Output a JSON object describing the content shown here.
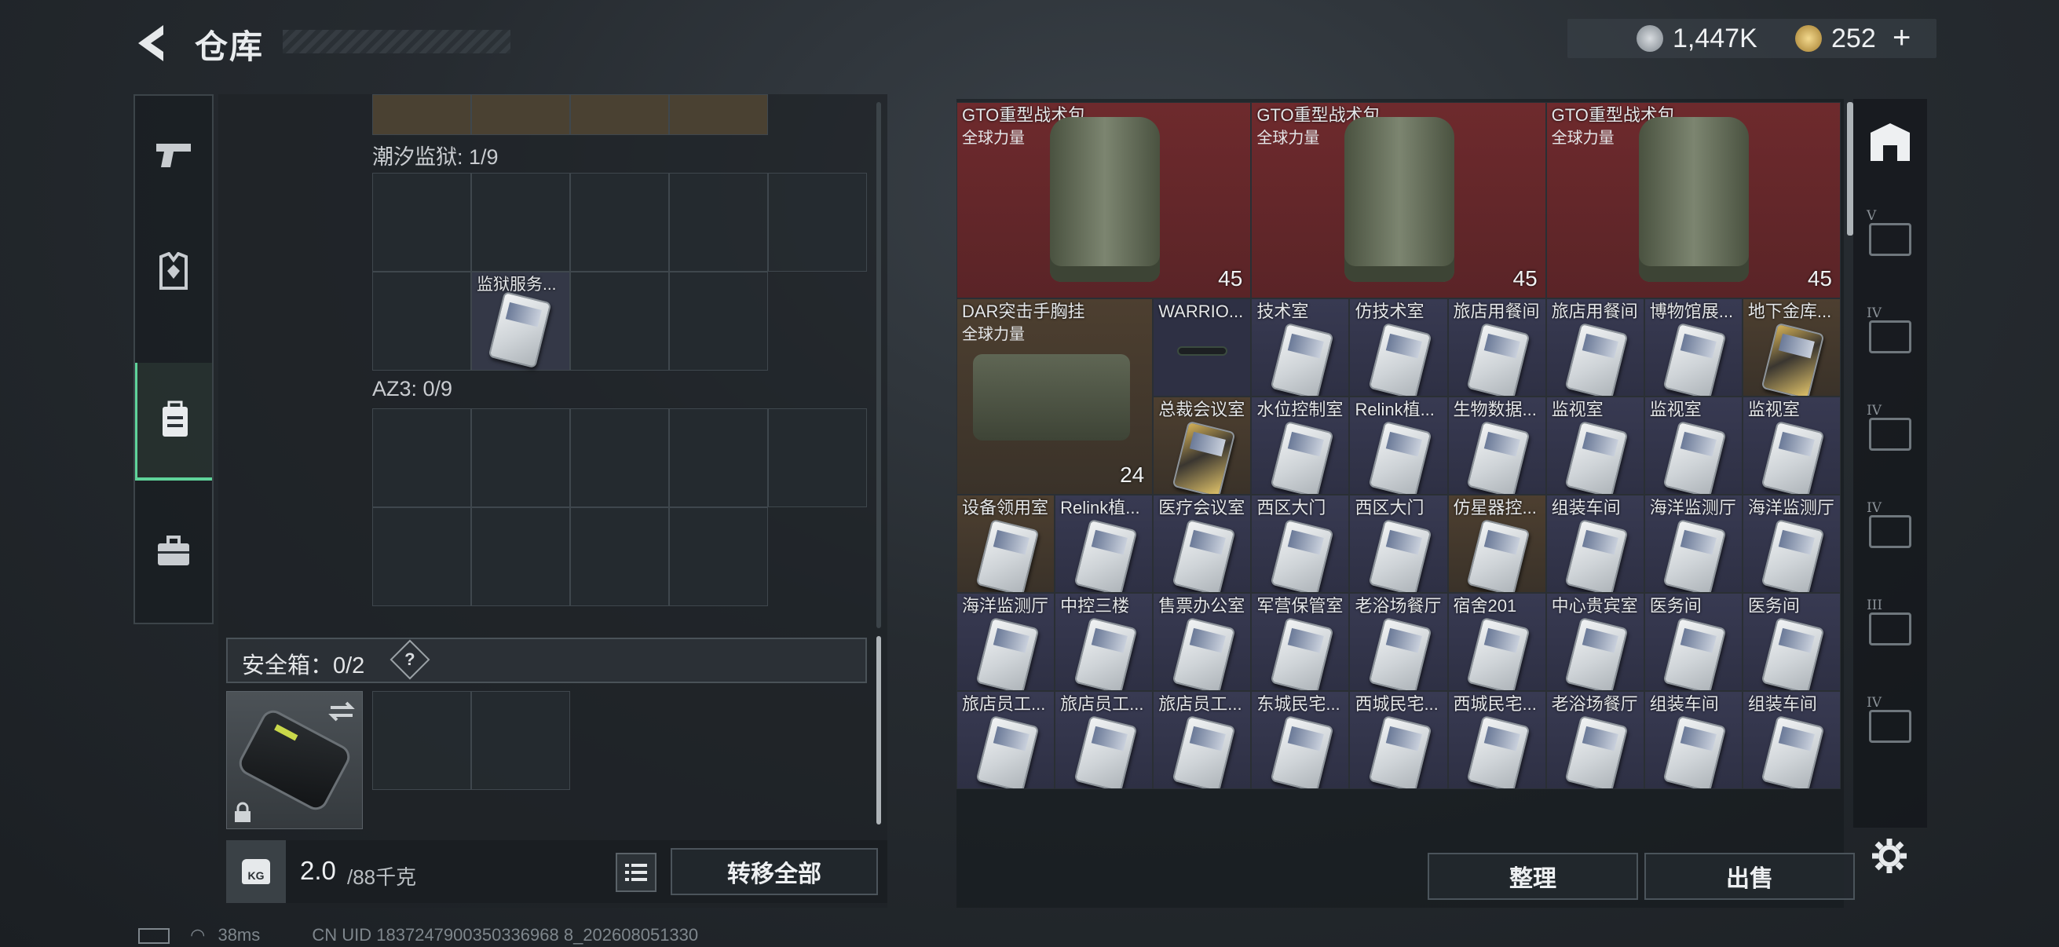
{
  "header": {
    "title": "仓库",
    "currency_silver": "1,447K",
    "currency_gold": "252",
    "gold_add": "+"
  },
  "left_sidebar": {
    "tabs": [
      {
        "icon": "pistol-icon",
        "active": false
      },
      {
        "icon": "vest-icon",
        "active": false
      },
      {
        "icon": "backpack-icon",
        "active": true
      },
      {
        "icon": "briefcase-icon",
        "active": false
      }
    ]
  },
  "middle": {
    "tide_prison_label": "潮汐监狱: 1/9",
    "tide_prison_item": "监狱服务...",
    "az3_label": "AZ3: 0/9",
    "safe_box_label": "安全箱：0/2",
    "safe_box_help": "?",
    "weight_value": "2.0",
    "weight_max": "/88千克",
    "weight_icon_label": "KG",
    "transfer_all": "转移全部"
  },
  "stash": {
    "big_items": [
      {
        "name": "GTO重型战术包",
        "sub": "全球力量",
        "count": "45"
      },
      {
        "name": "GTO重型战术包",
        "sub": "全球力量",
        "count": "45"
      },
      {
        "name": "GTO重型战术包",
        "sub": "全球力量",
        "count": "45"
      }
    ],
    "chest_rig": {
      "name": "DAR突击手胸挂",
      "sub": "全球力量",
      "count": "24"
    },
    "row1": [
      "WARRIO...",
      "技术室",
      "仿技术室",
      "旅店用餐间",
      "旅店用餐间",
      "博物馆展...",
      "地下金库..."
    ],
    "row2": [
      "总裁会议室",
      "水位控制室",
      "Relink植...",
      "生物数据...",
      "监视室",
      "监视室",
      "监视室"
    ],
    "row3": [
      "设备领用室",
      "Relink植...",
      "医疗会议室",
      "西区大门",
      "西区大门",
      "仿星器控...",
      "组装车间",
      "海洋监测厅",
      "海洋监测厅"
    ],
    "row4": [
      "海洋监测厅",
      "中控三楼",
      "售票办公室",
      "军营保管室",
      "老浴场餐厅",
      "宿舍201",
      "中心贵宾室",
      "医务间",
      "医务间"
    ],
    "row5": [
      "旅店员工...",
      "旅店员工...",
      "旅店员工...",
      "东城民宅...",
      "西城民宅...",
      "西城民宅...",
      "老浴场餐厅",
      "组装车间",
      "组装车间"
    ],
    "sort_button": "整理",
    "sell_button": "出售"
  },
  "right_sidebar": {
    "tabs": [
      {
        "icon": "home-stash-icon",
        "tier": ""
      },
      {
        "icon": "tier5-case-icon",
        "tier": "V"
      },
      {
        "icon": "tier4-medical-icon",
        "tier": "IV"
      },
      {
        "icon": "tier4-ammo-icon",
        "tier": "IV"
      },
      {
        "icon": "tier4-key-icon",
        "tier": "IV"
      },
      {
        "icon": "tier3-container-icon",
        "tier": "III"
      },
      {
        "icon": "tier4-tool-icon",
        "tier": "IV"
      }
    ]
  },
  "status_bar": {
    "ping": "38ms",
    "uid": "CN UID 1837247900350336968 8_202608051330"
  },
  "colors": {
    "accent_green": "#5fd39a",
    "red_rarity": "#6b2a2c",
    "gold_rarity": "#4a3a2a",
    "purple_rarity": "#33344a"
  }
}
